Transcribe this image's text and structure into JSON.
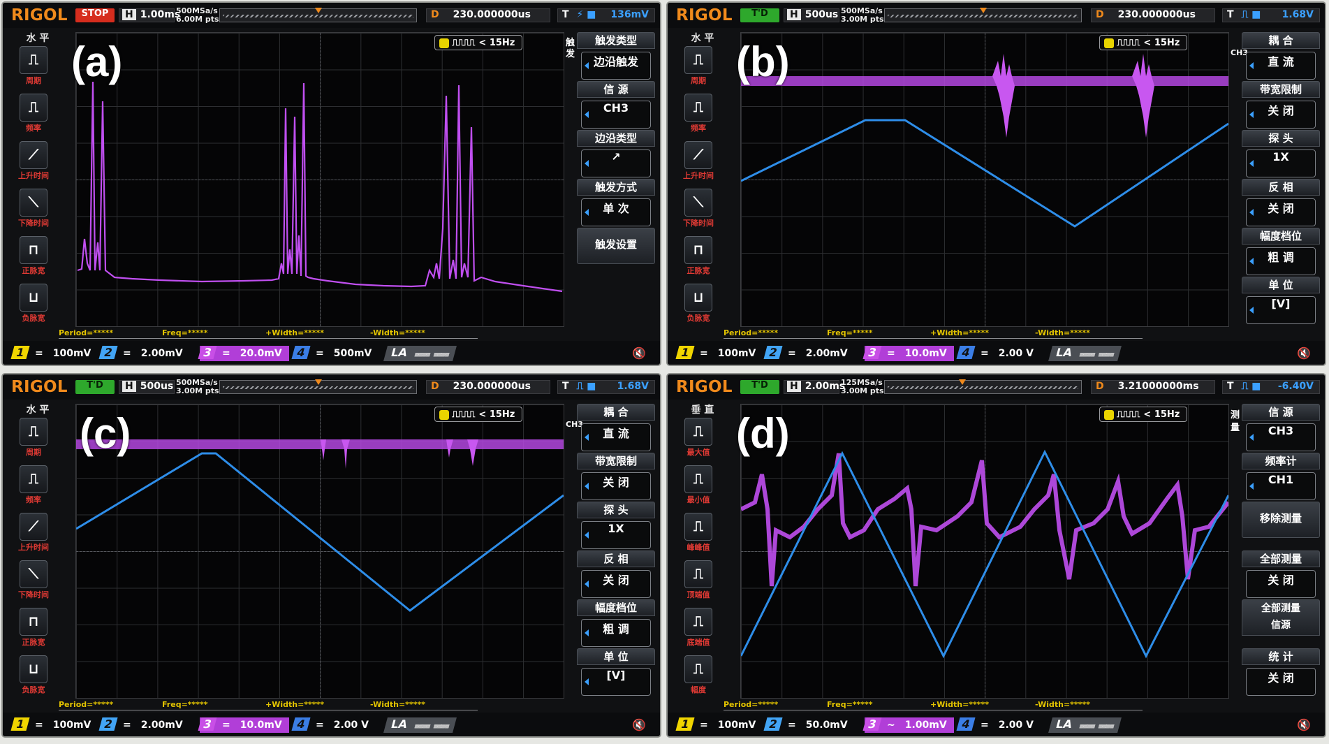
{
  "panels": [
    {
      "label": "(a)",
      "logo": "RIGOL",
      "run_state": "STOP",
      "timebase": "1.00ms",
      "sample_rate": "500MSa/s",
      "memory_depth": "6.00M pts",
      "delay_label": "D",
      "delay": "230.000000us",
      "trigger_level": "136mV",
      "trigger_freq": "< 15Hz",
      "left_menu_title": "水 平",
      "left_buttons": [
        "周期",
        "频率",
        "上升时间",
        "下降时间",
        "正脉宽",
        "负脉宽"
      ],
      "right_side_label": "触 发",
      "right_menu": [
        {
          "title": "触发类型",
          "value": "边沿触发"
        },
        {
          "title": "信 源",
          "value": "CH3"
        },
        {
          "title": "边沿类型",
          "value": "↗"
        },
        {
          "title": "触发方式",
          "value": "单 次"
        },
        {
          "title": "触发设置",
          "value": ""
        }
      ],
      "measurements": [
        "Period=*****",
        "Freq=*****",
        "+Width=*****",
        "-Width=*****"
      ],
      "channels": [
        {
          "num": "1",
          "coupling": "=",
          "scale": "100mV"
        },
        {
          "num": "2",
          "coupling": "=",
          "scale": "2.00mV"
        },
        {
          "num": "3",
          "coupling": "=",
          "scale": "20.0mV"
        },
        {
          "num": "4",
          "coupling": "=",
          "scale": "500mV"
        }
      ],
      "la": "LA"
    },
    {
      "label": "(b)",
      "logo": "RIGOL",
      "run_state": "T'D",
      "timebase": "500us",
      "sample_rate": "500MSa/s",
      "memory_depth": "3.00M pts",
      "delay_label": "D",
      "delay": "230.000000us",
      "trigger_level": "1.68V",
      "trigger_freq": "< 15Hz",
      "left_menu_title": "水 平",
      "left_buttons": [
        "周期",
        "频率",
        "上升时间",
        "下降时间",
        "正脉宽",
        "负脉宽"
      ],
      "right_side_label": "CH3",
      "right_menu": [
        {
          "title": "耦 合",
          "value": "直 流"
        },
        {
          "title": "带宽限制",
          "value": "关 闭"
        },
        {
          "title": "探 头",
          "value": "1X"
        },
        {
          "title": "反 相",
          "value": "关 闭"
        },
        {
          "title": "幅度档位",
          "value": "粗 调"
        },
        {
          "title": "单 位",
          "value": "[V]"
        }
      ],
      "measurements": [
        "Period=*****",
        "Freq=*****",
        "+Width=*****",
        "-Width=*****"
      ],
      "channels": [
        {
          "num": "1",
          "coupling": "=",
          "scale": "100mV"
        },
        {
          "num": "2",
          "coupling": "=",
          "scale": "2.00mV"
        },
        {
          "num": "3",
          "coupling": "=",
          "scale": "10.0mV"
        },
        {
          "num": "4",
          "coupling": "=",
          "scale": "2.00 V"
        }
      ],
      "la": "LA"
    },
    {
      "label": "(c)",
      "logo": "RIGOL",
      "run_state": "T'D",
      "timebase": "500us",
      "sample_rate": "500MSa/s",
      "memory_depth": "3.00M pts",
      "delay_label": "D",
      "delay": "230.000000us",
      "trigger_level": "1.68V",
      "trigger_freq": "< 15Hz",
      "left_menu_title": "水 平",
      "left_buttons": [
        "周期",
        "频率",
        "上升时间",
        "下降时间",
        "正脉宽",
        "负脉宽"
      ],
      "right_side_label": "CH3",
      "right_menu": [
        {
          "title": "耦 合",
          "value": "直 流"
        },
        {
          "title": "带宽限制",
          "value": "关 闭"
        },
        {
          "title": "探 头",
          "value": "1X"
        },
        {
          "title": "反 相",
          "value": "关 闭"
        },
        {
          "title": "幅度档位",
          "value": "粗 调"
        },
        {
          "title": "单 位",
          "value": "[V]"
        }
      ],
      "measurements": [
        "Period=*****",
        "Freq=*****",
        "+Width=*****",
        "-Width=*****"
      ],
      "channels": [
        {
          "num": "1",
          "coupling": "=",
          "scale": "100mV"
        },
        {
          "num": "2",
          "coupling": "=",
          "scale": "2.00mV"
        },
        {
          "num": "3",
          "coupling": "=",
          "scale": "10.0mV"
        },
        {
          "num": "4",
          "coupling": "=",
          "scale": "2.00 V"
        }
      ],
      "la": "LA"
    },
    {
      "label": "(d)",
      "logo": "RIGOL",
      "run_state": "T'D",
      "timebase": "2.00ms",
      "sample_rate": "125MSa/s",
      "memory_depth": "3.00M pts",
      "delay_label": "D",
      "delay": "3.21000000ms",
      "trigger_level": "-6.40V",
      "trigger_freq": "< 15Hz",
      "left_menu_title": "垂 直",
      "left_buttons": [
        "最大值",
        "最小值",
        "峰峰值",
        "顶端值",
        "底端值",
        "幅度"
      ],
      "right_side_label": "测 量",
      "right_menu": [
        {
          "title": "信 源",
          "value": "CH3"
        },
        {
          "title": "频率计",
          "value": "CH1"
        },
        {
          "title": "移除测量",
          "value": ""
        },
        {
          "title": "全部测量",
          "value": "关 闭"
        },
        {
          "title": "全部测量",
          "value": "信源"
        },
        {
          "title": "统 计",
          "value": "关 闭"
        }
      ],
      "measurements": [
        "Period=*****",
        "Freq=*****",
        "+Width=*****",
        "-Width=*****"
      ],
      "channels": [
        {
          "num": "1",
          "coupling": "=",
          "scale": "100mV"
        },
        {
          "num": "2",
          "coupling": "=",
          "scale": "50.0mV"
        },
        {
          "num": "3",
          "coupling": "~",
          "scale": "1.00mV"
        },
        {
          "num": "4",
          "coupling": "=",
          "scale": "2.00 V"
        }
      ],
      "la": "LA"
    }
  ],
  "colors": {
    "ch3_trace": "#c04ff0",
    "ch4_trace": "#2e8de8",
    "accent": "#f08a1c"
  }
}
